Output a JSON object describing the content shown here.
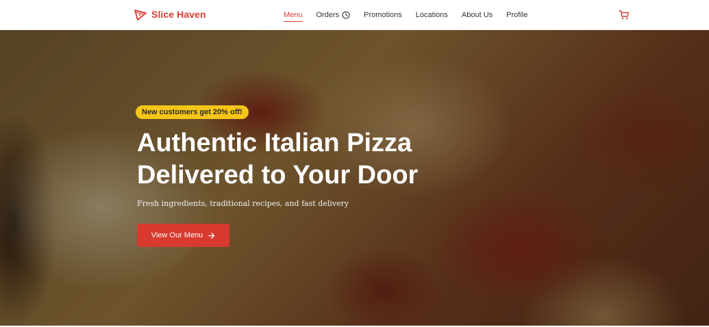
{
  "brand": {
    "name": "Slice Haven",
    "icon": "pizza-slice-icon",
    "color": "#d63b30"
  },
  "nav": {
    "items": [
      {
        "label": "Menu",
        "active": true
      },
      {
        "label": "Orders",
        "icon": "clock-icon"
      },
      {
        "label": "Promotions"
      },
      {
        "label": "Locations"
      },
      {
        "label": "About Us"
      },
      {
        "label": "Profile"
      }
    ],
    "cart_icon": "cart-icon"
  },
  "hero": {
    "badge": "New customers get 20% off!",
    "title_line1": "Authentic Italian Pizza",
    "title_line2": "Delivered to Your Door",
    "subtitle": "Fresh ingredients, traditional recipes, and fast delivery",
    "cta_label": "View Our Menu",
    "cta_icon": "arrow-right-icon"
  },
  "colors": {
    "accent": "#d83a2f",
    "badge": "#f5c518"
  }
}
